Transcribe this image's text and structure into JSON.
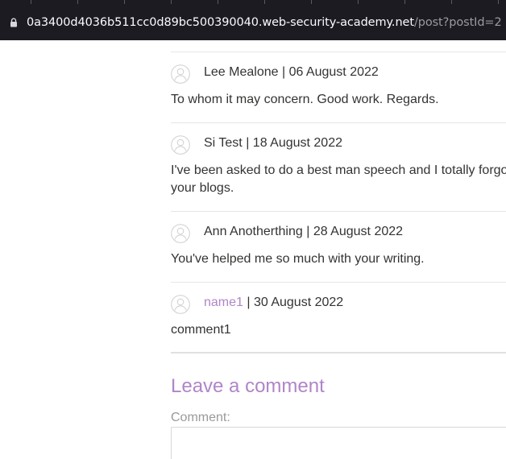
{
  "browser": {
    "url_host": "0a3400d4036b511cc0d89bc500390040.web-security-academy.net",
    "url_path": "/post?postId=2",
    "lock_icon": "lock-icon"
  },
  "comments": [
    {
      "author": "Lee Mealone",
      "date": "| 06 August 2022",
      "text": [
        "To whom it may concern. Good work. Regards."
      ]
    },
    {
      "author": "Si Test",
      "date": "| 18 August 2022",
      "text": [
        "I've been asked to do a best man speech and I totally forgo",
        "your blogs."
      ]
    },
    {
      "author": "Ann Anotherthing",
      "date": "| 28 August 2022",
      "text": [
        "You've helped me so much with your writing."
      ]
    },
    {
      "author": "name1",
      "date": "| 30 August 2022",
      "text": [
        "comment1"
      ],
      "author_is_link": true
    }
  ],
  "form": {
    "title": "Leave a comment",
    "comment_label": "Comment:"
  },
  "colors": {
    "accent": "#b085c8",
    "text": "#333332",
    "chrome": "#1c1b22"
  }
}
